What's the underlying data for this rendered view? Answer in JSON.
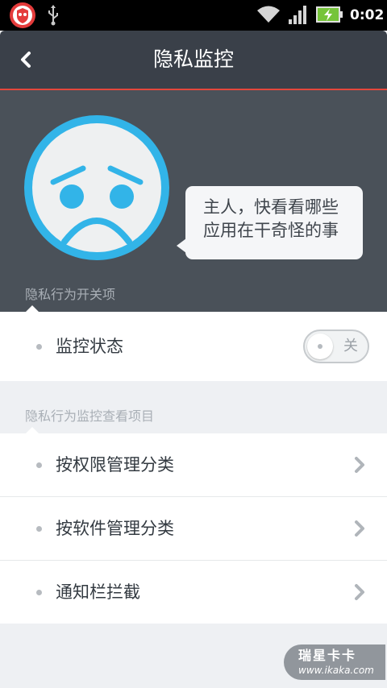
{
  "status_bar": {
    "time": "0:02",
    "icons": [
      "app-shield-icon",
      "usb-icon",
      "wifi-icon",
      "signal-icon",
      "battery-charging-icon"
    ]
  },
  "header": {
    "title": "隐私监控",
    "back_icon": "back-arrow-icon"
  },
  "hero": {
    "mascot_icon": "sad-face-icon",
    "bubble_lines": [
      "主人，快看看哪些",
      "应用在干奇怪的事"
    ],
    "section_label": "隐私行为开关项"
  },
  "switch_section": {
    "row_label": "监控状态",
    "toggle_state_label": "关",
    "toggle_on": false
  },
  "view_section": {
    "label": "隐私行为监控查看项目",
    "items": [
      {
        "label": "按权限管理分类"
      },
      {
        "label": "按软件管理分类"
      },
      {
        "label": "通知栏拦截"
      }
    ]
  },
  "watermark": {
    "title": "瑞星卡卡",
    "url": "www.ikaka.com"
  },
  "colors": {
    "accent_red": "#e5473c",
    "header_bg": "#3a4049",
    "hero_bg": "#4a5159",
    "face_blue": "#32b4e8"
  }
}
